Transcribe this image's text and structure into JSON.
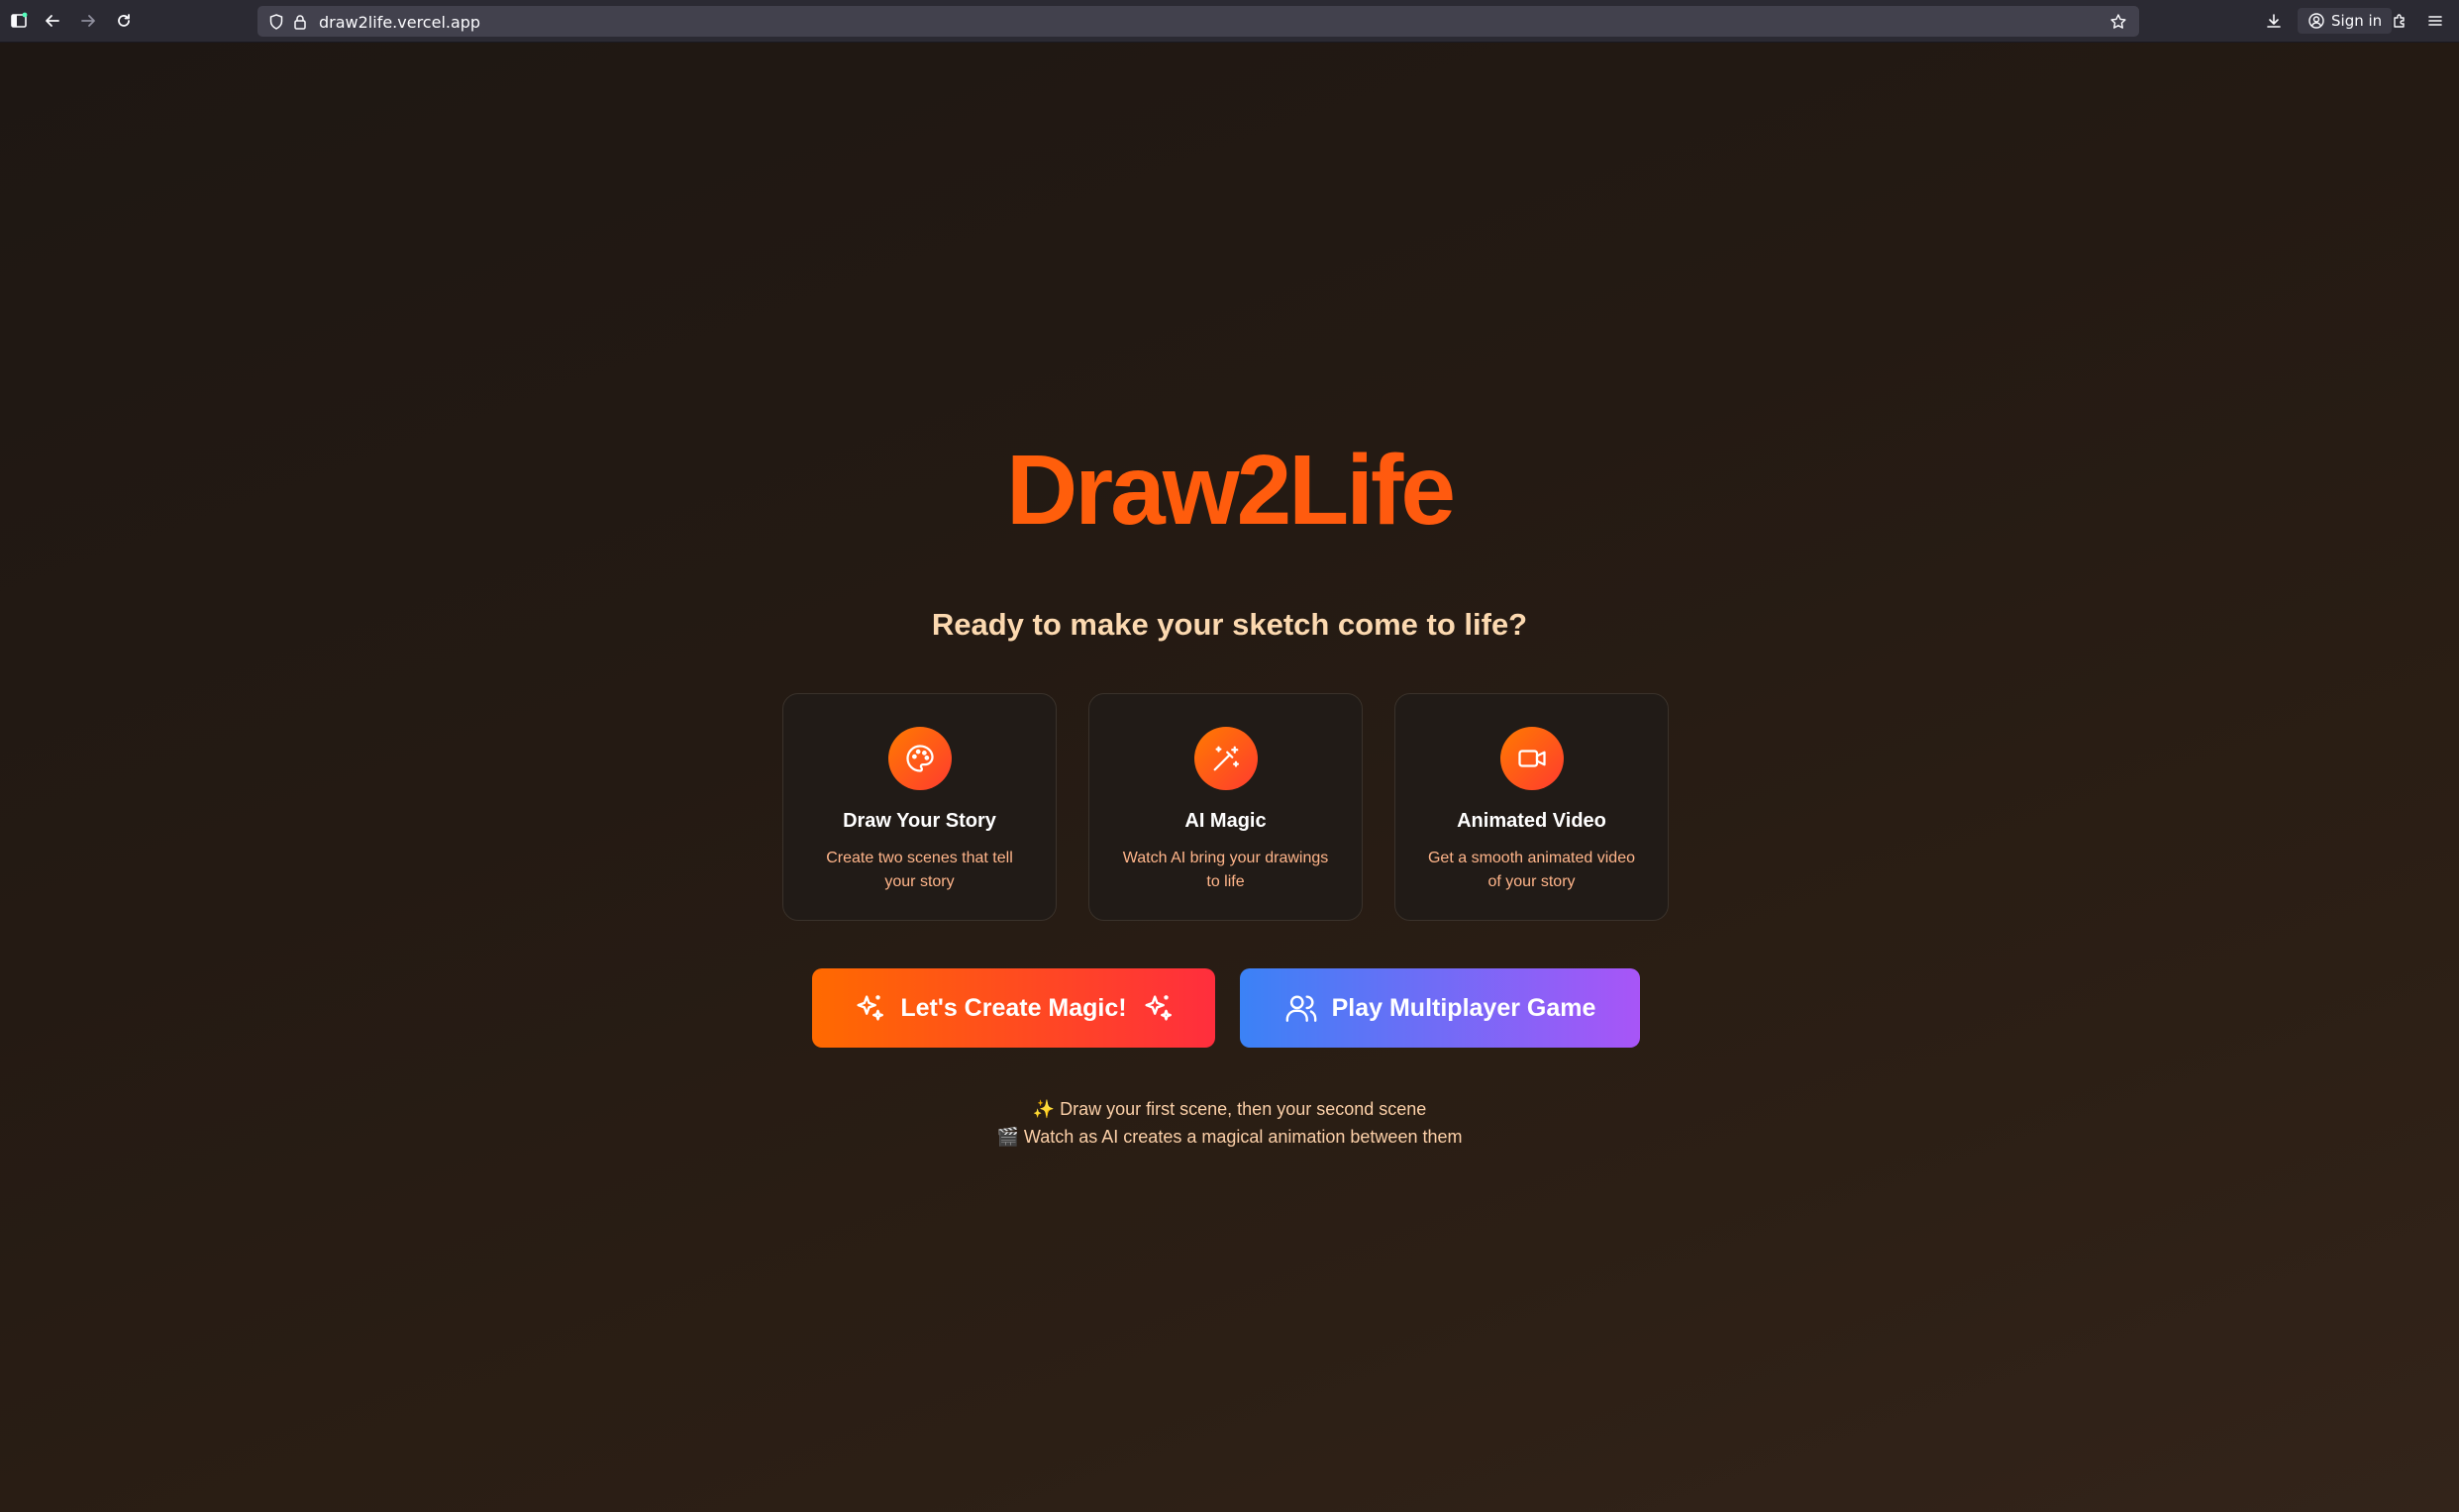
{
  "browser": {
    "url": "draw2life.vercel.app",
    "signin_label": "Sign in"
  },
  "hero": {
    "title": "Draw2Life",
    "subtitle": "Ready to make your sketch come to life?"
  },
  "features": [
    {
      "icon": "palette-icon",
      "title": "Draw Your Story",
      "description": "Create two scenes that tell your story"
    },
    {
      "icon": "magic-wand-icon",
      "title": "AI Magic",
      "description": "Watch AI bring your drawings to life"
    },
    {
      "icon": "video-camera-icon",
      "title": "Animated Video",
      "description": "Get a smooth animated video of your story"
    }
  ],
  "actions": {
    "create_label": "Let's Create Magic!",
    "multiplayer_label": "Play Multiplayer Game"
  },
  "hints": {
    "line1": "✨ Draw your first scene, then your second scene",
    "line2": "🎬 Watch as AI creates a magical animation between them"
  },
  "colors": {
    "accent_orange": "#ff6a00",
    "accent_red": "#ff2e3d",
    "accent_blue": "#3b82f6",
    "accent_purple": "#a855f7",
    "subtitle_cream": "#fcd9b0"
  }
}
